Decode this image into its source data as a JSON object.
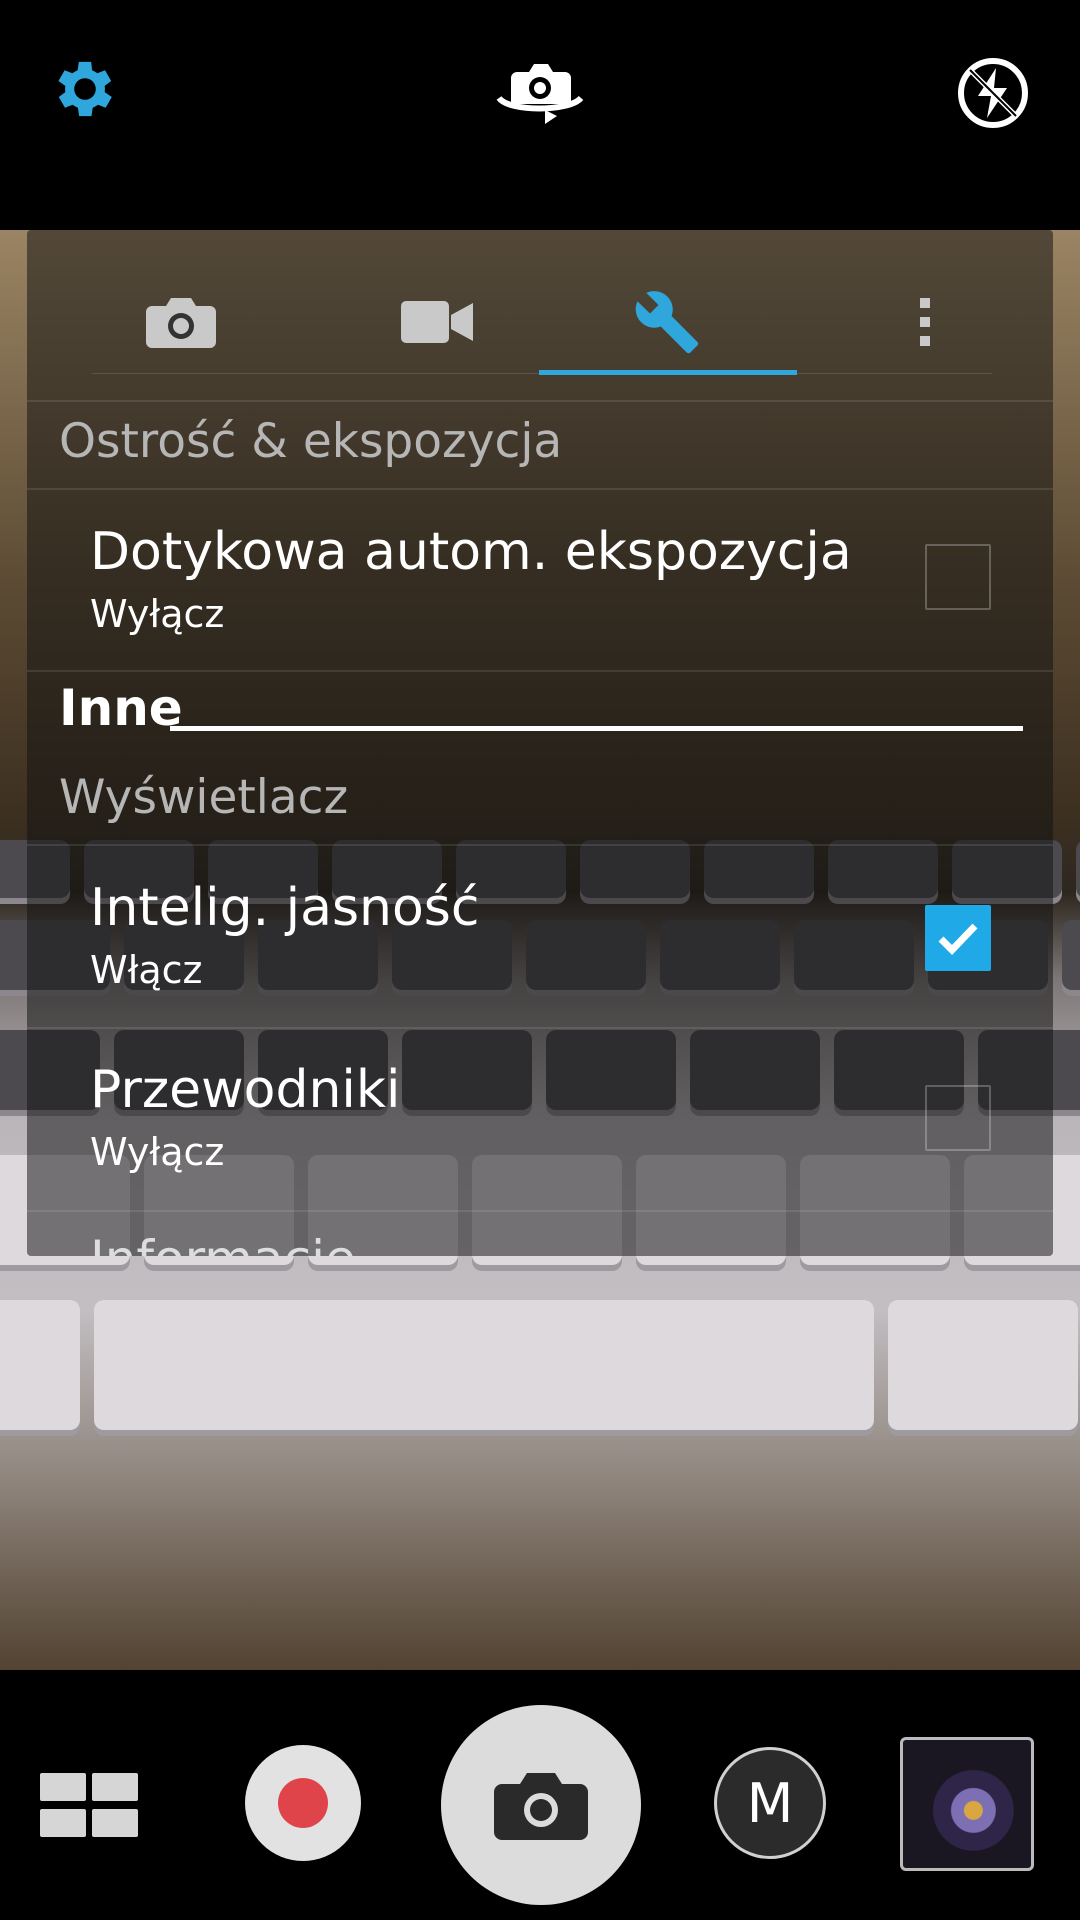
{
  "top_bar": {
    "settings_icon": "gear-icon",
    "switch_camera_icon": "camera-switch-icon",
    "flash_icon": "flash-off-icon"
  },
  "colors": {
    "accent": "#2fa6dc",
    "record": "#e0444b"
  },
  "settings_panel": {
    "tabs": [
      {
        "icon": "camera-icon",
        "active": false
      },
      {
        "icon": "video-camera-icon",
        "active": false
      },
      {
        "icon": "wrench-icon",
        "active": true
      },
      {
        "icon": "more-vertical-icon",
        "active": false
      }
    ],
    "sections": [
      {
        "title": "Ostrość & ekspozycja",
        "items": [
          {
            "title": "Dotykowa autom. ekspozycja",
            "subtitle": "Wyłącz",
            "checked": false
          }
        ]
      }
    ],
    "group_title": "Inne",
    "display_section": {
      "title": "Wyświetlacz",
      "items": [
        {
          "title": "Intelig. jasność",
          "subtitle": "Włącz",
          "checked": true
        },
        {
          "title": "Przewodniki",
          "subtitle": "Wyłącz",
          "checked": false
        }
      ]
    },
    "truncated_next": "Informacje"
  },
  "bottom_bar": {
    "layout_icon": "grid-layout-icon",
    "record_icon": "record-icon",
    "shutter_icon": "camera-icon",
    "mode_label": "M",
    "gallery_icon": "gallery-thumbnail"
  }
}
